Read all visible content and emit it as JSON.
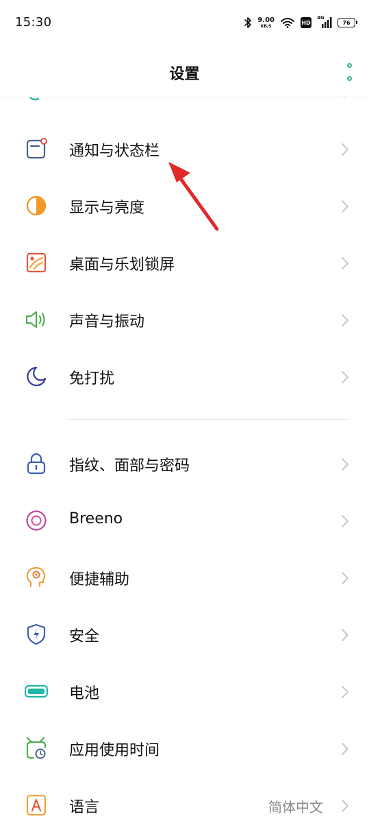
{
  "status_bar": {
    "time": "15:30",
    "net_speed_value": "9.00",
    "net_speed_unit": "KB/S",
    "hd": "HD",
    "network_type": "4G",
    "battery": "76"
  },
  "header": {
    "title": "设置"
  },
  "rows": [
    {
      "label": "通知与状态栏",
      "icon": "notification-icon"
    },
    {
      "label": "显示与亮度",
      "icon": "brightness-icon"
    },
    {
      "label": "桌面与乐划锁屏",
      "icon": "wallpaper-icon"
    },
    {
      "label": "声音与振动",
      "icon": "speaker-icon"
    },
    {
      "label": "免打扰",
      "icon": "moon-icon"
    },
    {
      "label": "指纹、面部与密码",
      "icon": "lock-icon"
    },
    {
      "label": "Breeno",
      "icon": "breeno-icon"
    },
    {
      "label": "便捷辅助",
      "icon": "assist-head-icon"
    },
    {
      "label": "安全",
      "icon": "shield-icon"
    },
    {
      "label": "电池",
      "icon": "battery-icon"
    },
    {
      "label": "应用使用时间",
      "icon": "app-timer-icon"
    },
    {
      "label": "语言",
      "icon": "language-icon",
      "value": "简体中文"
    }
  ],
  "colors": {
    "accent_green": "#2fb574",
    "annotation_arrow": "#e02a2a"
  }
}
